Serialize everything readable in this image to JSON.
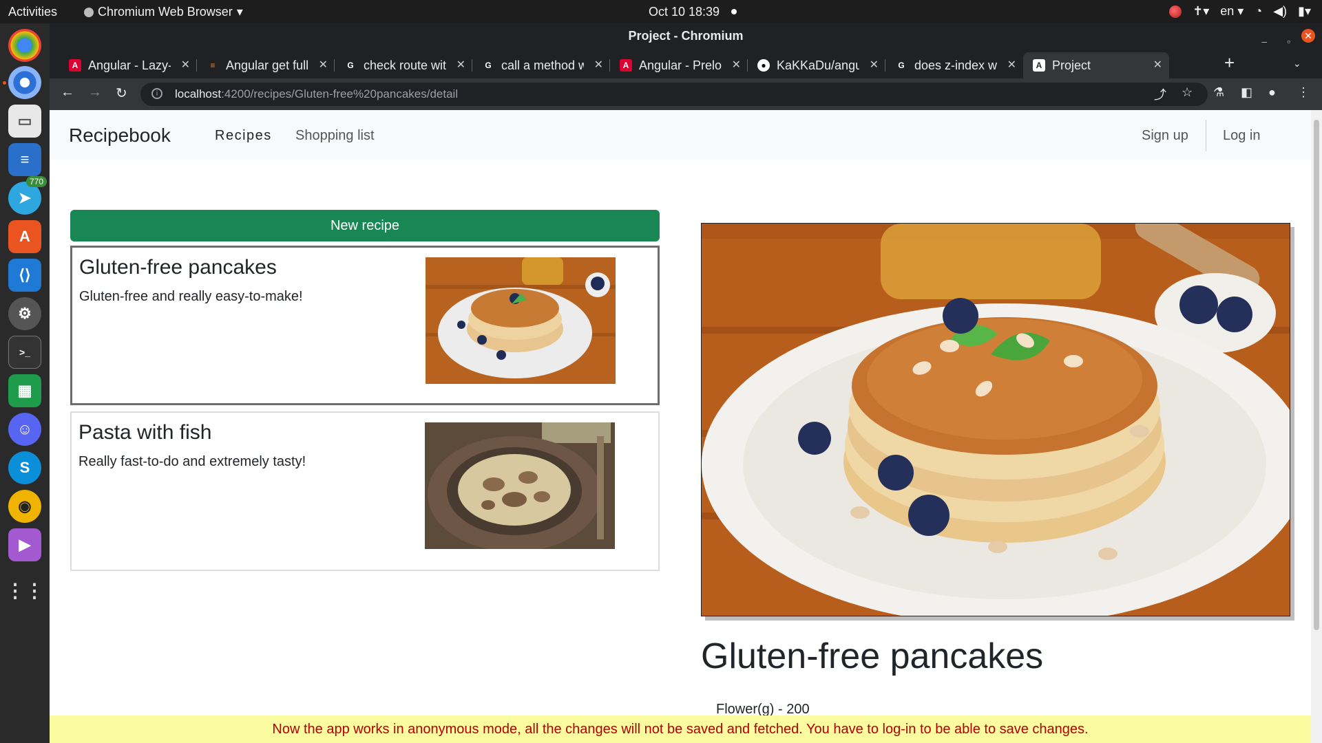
{
  "system": {
    "activities": "Activities",
    "app_name": "Chromium Web Browser",
    "clock": "Oct 10  18:39",
    "lang": "en",
    "telegram_badge": "770"
  },
  "window": {
    "title": "Project - Chromium"
  },
  "tabs": [
    {
      "title": "Angular - Lazy-loading",
      "favicon": "angular-icon"
    },
    {
      "title": "Angular get full url",
      "favicon": "stackoverflow-icon"
    },
    {
      "title": "check route with",
      "favicon": "google-icon"
    },
    {
      "title": "call a method with",
      "favicon": "google-icon"
    },
    {
      "title": "Angular - Preloading",
      "favicon": "angular-icon"
    },
    {
      "title": "KaKKaDu/angular",
      "favicon": "github-icon"
    },
    {
      "title": "does z-index work",
      "favicon": "google-icon"
    },
    {
      "title": "Project",
      "favicon": "angular-icon",
      "active": true
    }
  ],
  "address": {
    "host": "localhost",
    "path": ":4200/recipes/Gluten-free%20pancakes/detail"
  },
  "navbar": {
    "brand": "Recipebook",
    "links": [
      "Recipes",
      "Shopping list"
    ],
    "signup": "Sign up",
    "login": "Log in"
  },
  "recipes": {
    "new_button": "New recipe",
    "items": [
      {
        "name": "Gluten-free pancakes",
        "description": "Gluten-free and really easy-to-make!"
      },
      {
        "name": "Pasta with fish",
        "description": "Really fast-to-do and extremely tasty!"
      }
    ]
  },
  "detail": {
    "title": "Gluten-free pancakes",
    "ingredient_first": "Flower(g) - 200"
  },
  "banner": "Now the app works in anonymous mode, all the changes will not be saved and fetched. You have to log-in to be able to save changes.",
  "colors": {
    "accent_green": "#198754",
    "banner_bg": "#fbfba0",
    "banner_text": "#b30000"
  }
}
